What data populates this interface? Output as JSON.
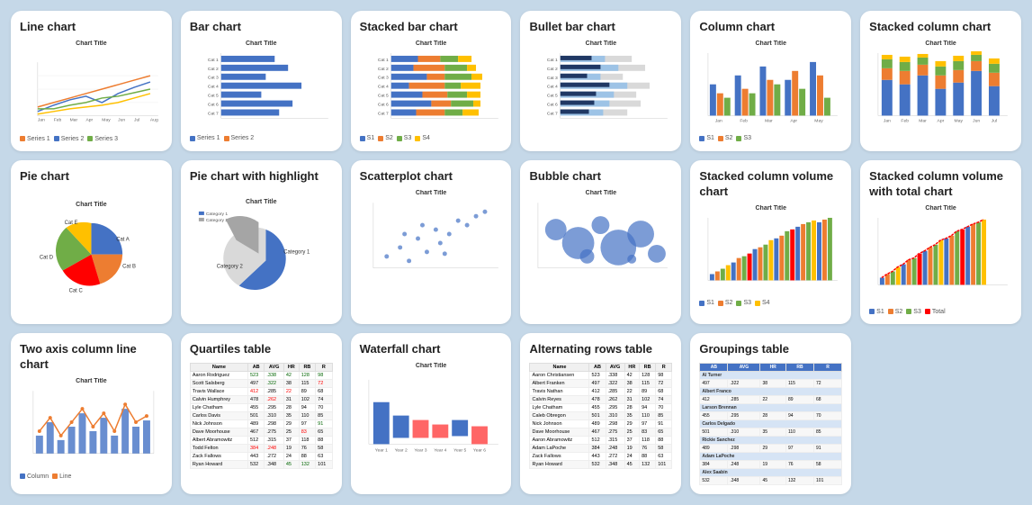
{
  "cards": [
    {
      "id": "line-chart",
      "title": "Line chart",
      "type": "line"
    },
    {
      "id": "bar-chart",
      "title": "Bar chart",
      "type": "bar"
    },
    {
      "id": "stacked-bar-chart",
      "title": "Stacked bar chart",
      "type": "stacked-bar"
    },
    {
      "id": "bullet-bar-chart",
      "title": "Bullet bar chart",
      "type": "bullet-bar"
    },
    {
      "id": "column-chart",
      "title": "Column chart",
      "type": "column"
    },
    {
      "id": "stacked-column-chart",
      "title": "Stacked column chart",
      "type": "stacked-column"
    },
    {
      "id": "pie-chart",
      "title": "Pie chart",
      "type": "pie"
    },
    {
      "id": "pie-highlight-chart",
      "title": "Pie chart with highlight",
      "type": "pie-highlight"
    },
    {
      "id": "scatterplot-chart",
      "title": "Scatterplot chart",
      "type": "scatter"
    },
    {
      "id": "bubble-chart",
      "title": "Bubble chart",
      "type": "bubble"
    },
    {
      "id": "stacked-col-volume",
      "title": "Stacked column volume chart",
      "type": "stacked-col-volume"
    },
    {
      "id": "stacked-col-volume-total",
      "title": "Stacked column volume with total chart",
      "type": "stacked-col-volume-total"
    },
    {
      "id": "two-axis-chart",
      "title": "Two axis column line chart",
      "type": "two-axis"
    },
    {
      "id": "quartiles-table",
      "title": "Quartiles table",
      "type": "quartiles-table"
    },
    {
      "id": "waterfall-chart",
      "title": "Waterfall chart",
      "type": "waterfall"
    },
    {
      "id": "alternating-rows-table",
      "title": "Alternating rows table",
      "type": "alt-rows-table"
    },
    {
      "id": "groupings-table",
      "title": "Groupings table",
      "type": "groupings-table"
    }
  ],
  "colors": {
    "blue": "#4472C4",
    "orange": "#ED7D31",
    "green": "#70AD47",
    "red": "#FF0000",
    "yellow": "#FFC000",
    "purple": "#7030A0",
    "gray": "#A5A5A5",
    "lightblue": "#9DC3E6",
    "darkblue": "#203864",
    "teal": "#008080",
    "brown": "#833C00"
  }
}
